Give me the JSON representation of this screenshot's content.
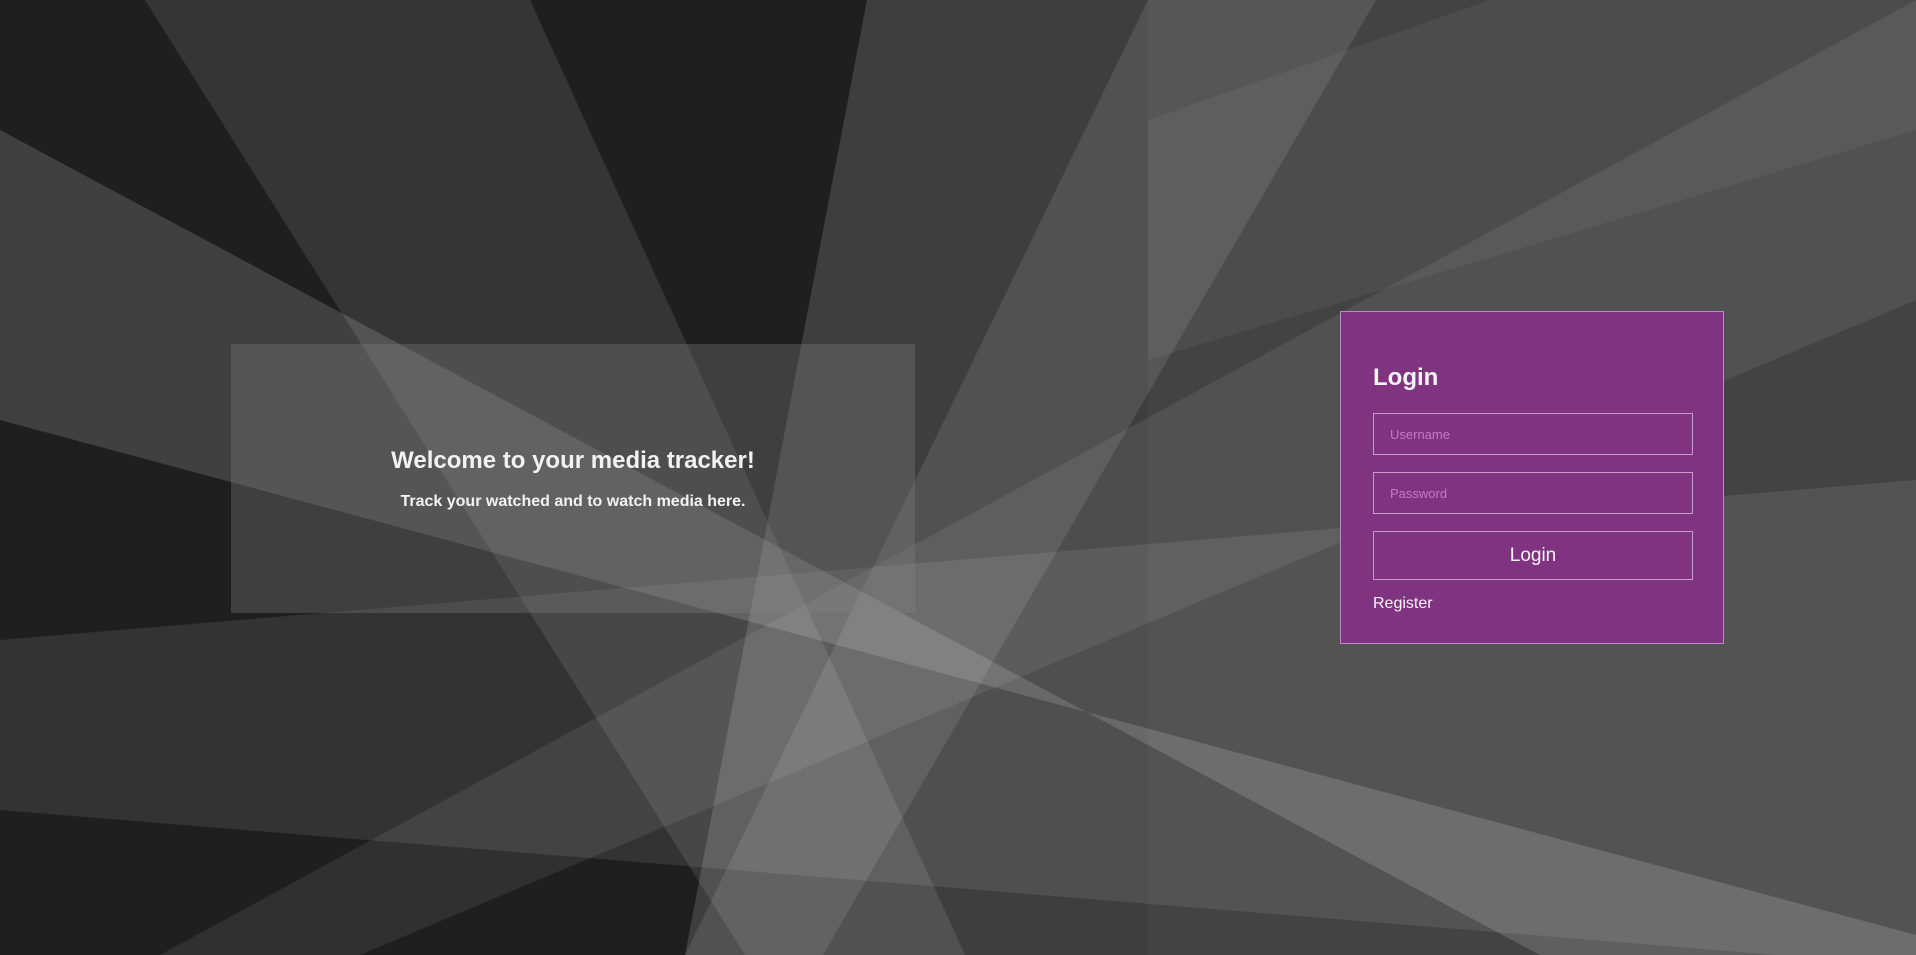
{
  "welcome": {
    "title": "Welcome to your media tracker!",
    "subtitle": "Track your watched and to watch media here."
  },
  "login": {
    "title": "Login",
    "username_placeholder": "Username",
    "password_placeholder": "Password",
    "button_label": "Login",
    "register_label": "Register"
  },
  "colors": {
    "background": "#1f1f1f",
    "card": "#7f3380",
    "card_border": "#c487c5",
    "placeholder": "#c07cc2"
  }
}
